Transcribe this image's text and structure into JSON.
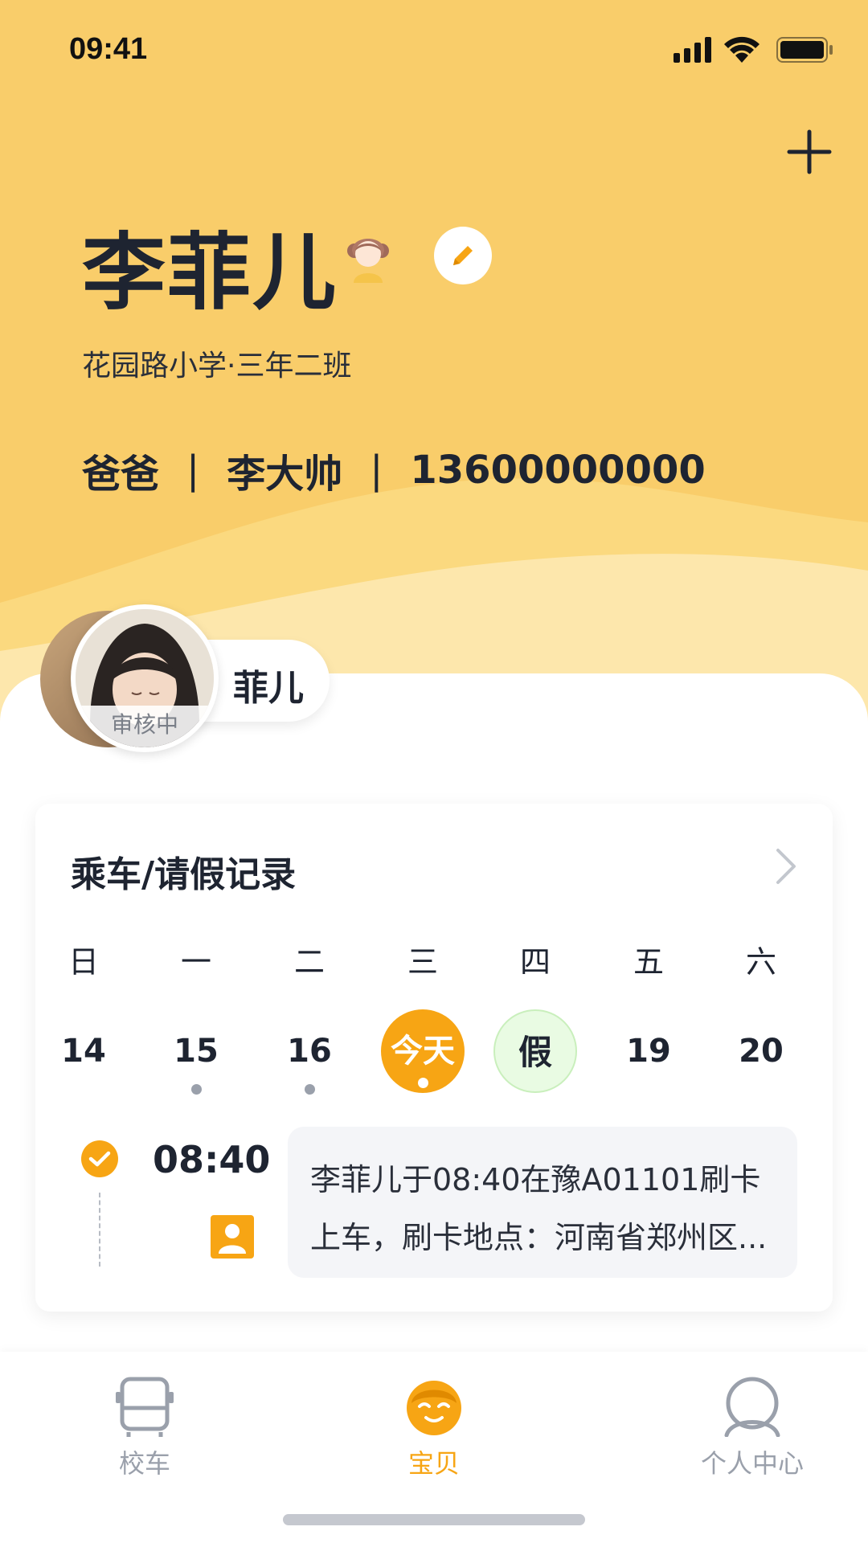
{
  "status_bar": {
    "time": "09:41"
  },
  "profile": {
    "name": "李菲儿",
    "school": "花园路小学·三年二班",
    "relation": "爸爸",
    "guardian_name": "李大帅",
    "phone": "13600000000"
  },
  "child_switcher": {
    "name": "菲儿",
    "status": "审核中"
  },
  "records": {
    "title": "乘车/请假记录",
    "weekdays": [
      "日",
      "一",
      "二",
      "三",
      "四",
      "五",
      "六"
    ],
    "dates": [
      "14",
      "15",
      "16",
      "今天",
      "假",
      "19",
      "20"
    ],
    "entry": {
      "time": "08:40",
      "message": "李菲儿于08:40在豫A01101刷卡上车，刷卡地点：河南省郑州区..."
    }
  },
  "tabbar": {
    "tabs": [
      {
        "label": "校车",
        "icon": "bus-icon"
      },
      {
        "label": "宝贝",
        "icon": "baby-face-icon",
        "active": true
      },
      {
        "label": "个人中心",
        "icon": "user-icon"
      }
    ]
  },
  "colors": {
    "header": "#f9cd6a",
    "accent": "#f7a514",
    "text": "#1e2431"
  }
}
